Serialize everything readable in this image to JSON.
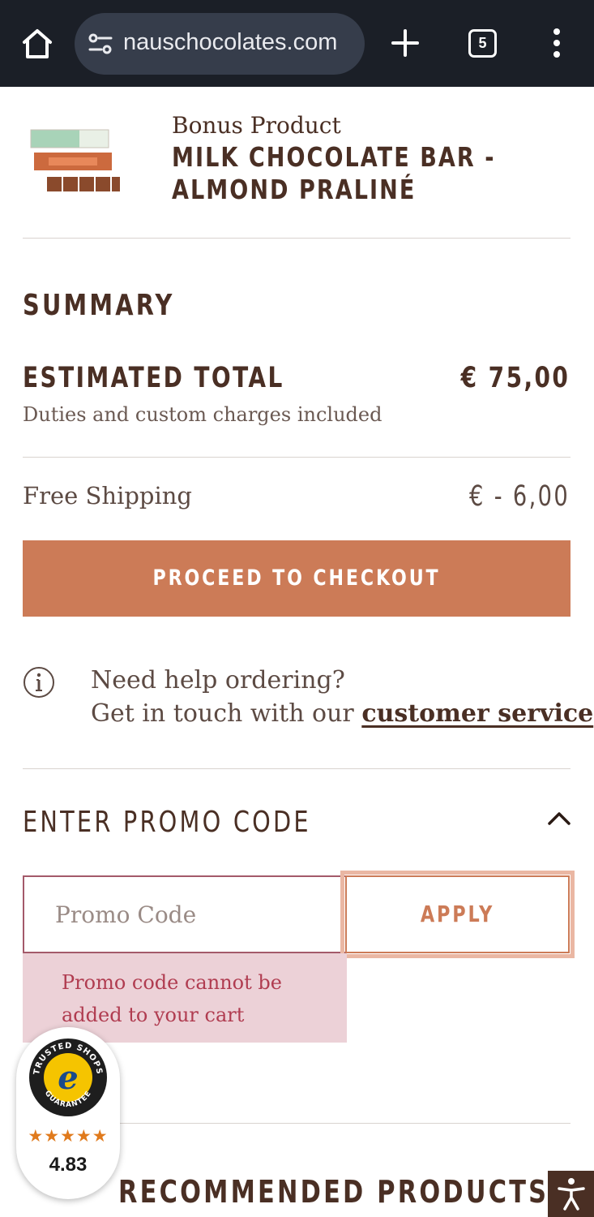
{
  "browser": {
    "url": "nauschocolates.com",
    "tab_count": "5",
    "icons": [
      "home-icon",
      "site-settings-icon",
      "new-tab-icon",
      "tab-switcher-icon",
      "more-menu-icon"
    ]
  },
  "bonus_product": {
    "kicker": "Bonus Product",
    "title": "MILK CHOCOLATE BAR - ALMOND PRALINÉ"
  },
  "summary": {
    "heading": "SUMMARY",
    "estimated_total_label": "ESTIMATED TOTAL",
    "estimated_total_value": "€ 75,00",
    "duties_note": "Duties and custom charges included",
    "shipping_label": "Free Shipping",
    "shipping_value": "€ - 6,00",
    "checkout_label": "PROCEED TO CHECKOUT"
  },
  "help": {
    "line1": "Need help ordering?",
    "line2_prefix": "Get in touch with our ",
    "link_label": "customer service"
  },
  "promo": {
    "heading": "ENTER PROMO CODE",
    "placeholder": "Promo Code",
    "value": "",
    "apply_label": "APPLY",
    "error_message": "Promo code cannot be added to your cart"
  },
  "recommended": {
    "heading": "RECOMMENDED PRODUCTS"
  },
  "trust_badge": {
    "seal_label": "TRUSTED SHOPS GUARANTEE",
    "stars": "★★★★★",
    "rating": 4.83,
    "score": "4.83"
  },
  "colors": {
    "accent": "#cc7b57",
    "brand_text": "#4a2f24",
    "error_bg": "#ecd1d7",
    "error_text": "#b03c50",
    "browser_bar": "#1b1f27"
  }
}
